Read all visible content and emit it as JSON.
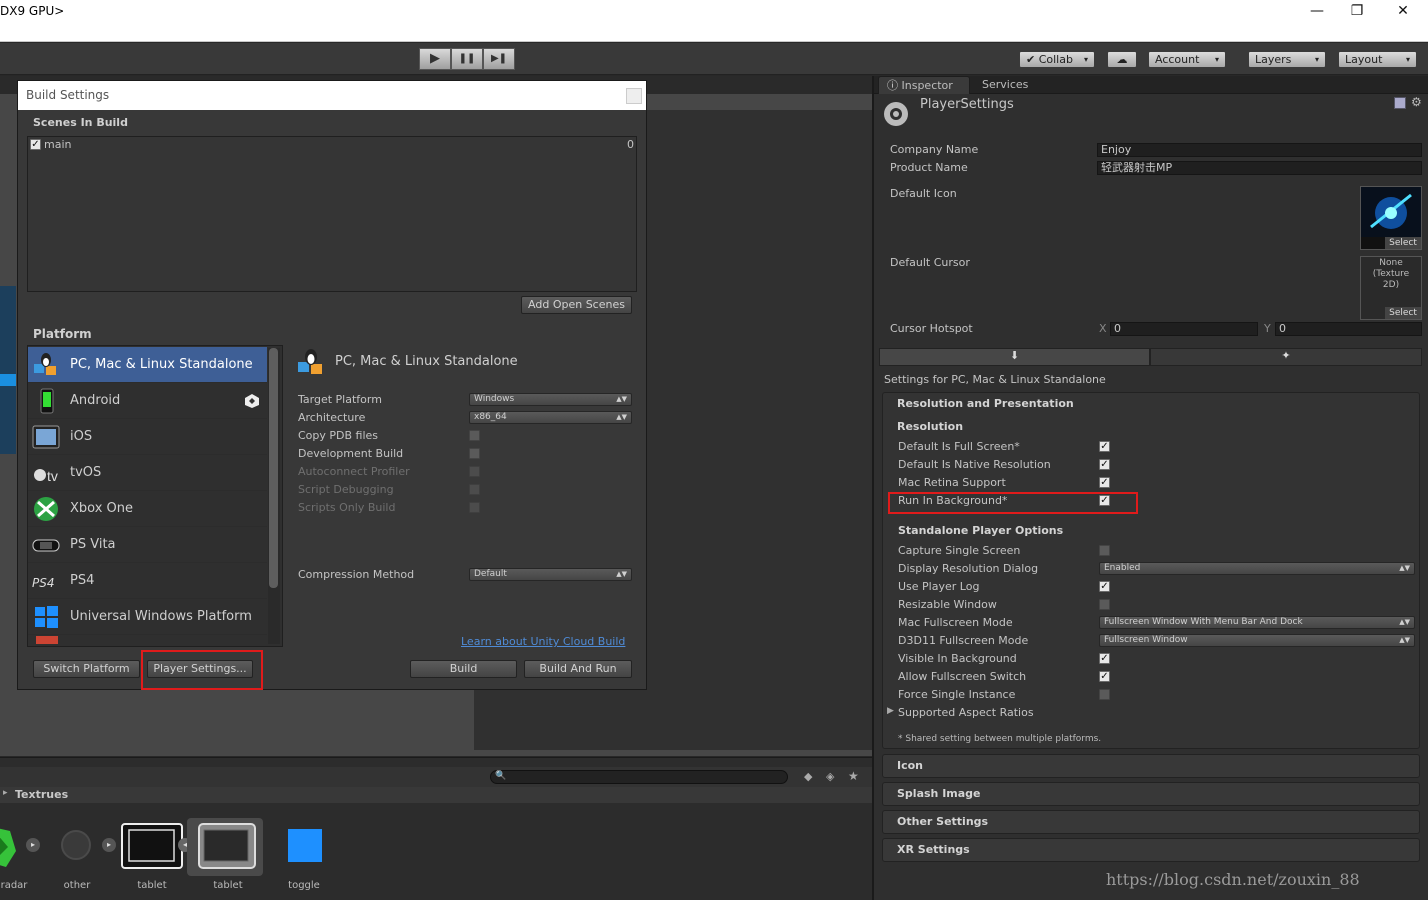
{
  "window": {
    "title": "DX9 GPU>",
    "min": "—",
    "max": "❐",
    "close": "✕"
  },
  "toolbar": {
    "play": "▶",
    "pause": "❚❚",
    "step": "▶❚",
    "collab": "✔ Collab",
    "cloud": "☁",
    "account": "Account",
    "layers": "Layers",
    "layout": "Layout",
    "arrow": "▾"
  },
  "inspector": {
    "tabs": [
      "Inspector",
      "Services"
    ],
    "title": "PlayerSettings",
    "company_label": "Company Name",
    "company_value": "Enjoy",
    "product_label": "Product Name",
    "product_value": "轻武器射击MP",
    "icon_label": "Default Icon",
    "select": "Select",
    "cursor_label": "Default Cursor",
    "cursor_none": "None\n(Texture\n2D)",
    "hotspot_label": "Cursor Hotspot",
    "hotspot_x_label": "X",
    "hotspot_x": "0",
    "hotspot_y_label": "Y",
    "hotspot_y": "0",
    "settings_for": "Settings for PC, Mac & Linux Standalone",
    "res_pres": "Resolution and Presentation",
    "resolution": "Resolution",
    "res_items": [
      {
        "label": "Default Is Full Screen*",
        "checked": true
      },
      {
        "label": "Default Is Native Resolution",
        "checked": true
      },
      {
        "label": "Mac Retina Support",
        "checked": true
      },
      {
        "label": "Run In Background*",
        "checked": true
      }
    ],
    "standalone": "Standalone Player Options",
    "sa_items": [
      {
        "label": "Capture Single Screen",
        "type": "check",
        "checked": false
      },
      {
        "label": "Display Resolution Dialog",
        "type": "dropdown",
        "value": "Enabled"
      },
      {
        "label": "Use Player Log",
        "type": "check",
        "checked": true
      },
      {
        "label": "Resizable Window",
        "type": "check",
        "checked": false
      },
      {
        "label": "Mac Fullscreen Mode",
        "type": "dropdown",
        "value": "Fullscreen Window With Menu Bar And Dock"
      },
      {
        "label": "D3D11 Fullscreen Mode",
        "type": "dropdown",
        "value": "Fullscreen Window"
      },
      {
        "label": "Visible In Background",
        "type": "check",
        "checked": true
      },
      {
        "label": "Allow Fullscreen Switch",
        "type": "check",
        "checked": true
      },
      {
        "label": "Force Single Instance",
        "type": "check",
        "checked": false
      }
    ],
    "aspect": "Supported Aspect Ratios",
    "shared_note": "* Shared setting between multiple platforms.",
    "sections": [
      "Icon",
      "Splash Image",
      "Other Settings",
      "XR Settings"
    ]
  },
  "build": {
    "title": "Build Settings",
    "scenes_header": "Scenes In Build",
    "scene_name": "main",
    "scene_index": "0",
    "add_open_scenes": "Add Open Scenes",
    "platform_header": "Platform",
    "platforms": [
      "PC, Mac & Linux Standalone",
      "Android",
      "iOS",
      "tvOS",
      "Xbox One",
      "PS Vita",
      "PS4",
      "Universal Windows Platform"
    ],
    "selected_platform": "PC, Mac & Linux Standalone",
    "opts": [
      {
        "label": "Target Platform",
        "type": "dropdown",
        "value": "Windows",
        "enabled": true
      },
      {
        "label": "Architecture",
        "type": "dropdown",
        "value": "x86_64",
        "enabled": true
      },
      {
        "label": "Copy PDB files",
        "type": "check",
        "enabled": true
      },
      {
        "label": "Development Build",
        "type": "check",
        "enabled": true
      },
      {
        "label": "Autoconnect Profiler",
        "type": "check",
        "enabled": false
      },
      {
        "label": "Script Debugging",
        "type": "check",
        "enabled": false
      },
      {
        "label": "Scripts Only Build",
        "type": "check",
        "enabled": false
      }
    ],
    "compression_label": "Compression Method",
    "compression_value": "Default",
    "cloud_link": "Learn about Unity Cloud Build",
    "switch_platform": "Switch Platform",
    "player_settings": "Player Settings...",
    "build": "Build",
    "build_and_run": "Build And Run"
  },
  "project": {
    "folder": "Textrues",
    "assets": [
      "radar",
      "other",
      "tablet",
      "tablet",
      "toggle"
    ]
  },
  "watermark": "https://blog.csdn.net/zouxin_88",
  "colors": {
    "selected": "#3e5f96",
    "highlight": "#e01b1b",
    "link": "#4f8bd6",
    "toggle_blue": "#1e90ff"
  }
}
